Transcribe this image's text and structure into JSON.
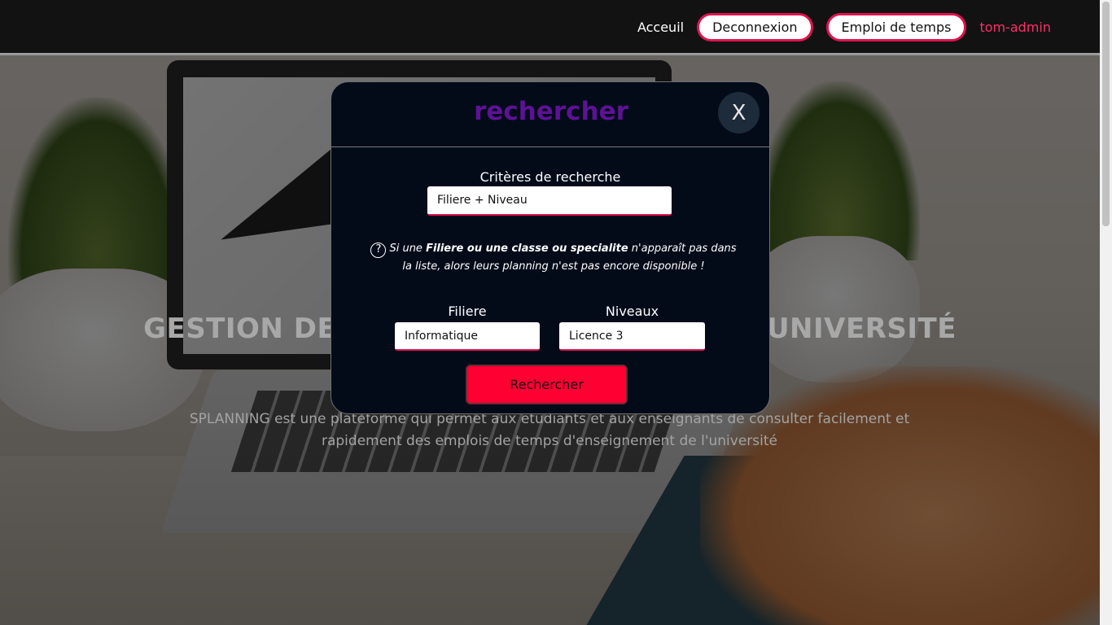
{
  "navbar": {
    "home_label": "Acceuil",
    "logout_label": "Deconnexion",
    "timetable_label": "Emploi de temps",
    "user_label": "tom-admin"
  },
  "hero": {
    "title": "GESTION DES EMPLOIS DE TEMPS DE L'UNIVERSITÉ",
    "description": "SPLANNING est une plateforme qui permet aux etudiants et aux enseignants de consulter facilement et rapidement des emplois de temps d'enseignement de l'université"
  },
  "modal": {
    "title": "rechercher",
    "close_label": "X",
    "criteria_label": "Critères de recherche",
    "criteria_value": "Filiere + Niveau",
    "help": {
      "icon": "question-circle-icon",
      "prefix": "Si une ",
      "bold": "Filiere ou une classe ou specialite",
      "suffix": " n'apparaît pas dans la liste, alors leurs planning n'est pas encore disponible !"
    },
    "filiere_label": "Filiere",
    "filiere_value": "Informatique",
    "niveaux_label": "Niveaux",
    "niveaux_value": "Licence 3",
    "submit_label": "Rechercher"
  },
  "colors": {
    "accent": "#e0134f",
    "user_link": "#ff2f67",
    "modal_title": "#5d1296",
    "submit_button": "#ff0033",
    "modal_bg": "#030b19"
  }
}
